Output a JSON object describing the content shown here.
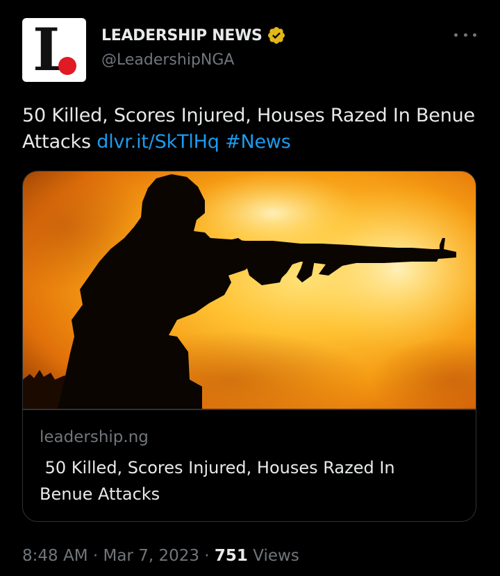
{
  "account": {
    "display_name": "LEADERSHIP NEWS",
    "handle": "@LeadershipNGA",
    "avatar_letter": "L",
    "verified": true
  },
  "tweet": {
    "text": "50 Killed, Scores Injured, Houses Razed In Benue Attacks",
    "link": "dlvr.it/SkTlHq",
    "hashtag": "#News"
  },
  "card": {
    "domain": "leadership.ng",
    "title": " 50 Killed, Scores Injured, Houses Razed In Benue Attacks"
  },
  "meta": {
    "time": "8:48 AM",
    "separator": " · ",
    "date": "Mar 7, 2023",
    "views_count": "751",
    "views_label": " Views"
  },
  "colors": {
    "background": "#000000",
    "text": "#e7e9ea",
    "secondary_text": "#71767b",
    "link": "#1d9bf0",
    "border": "#2f3336",
    "verified_badge": "#e2b719",
    "logo_dot": "#e01b24"
  },
  "icons": {
    "verified": "verified-badge-icon",
    "more": "more-horizontal-icon"
  }
}
